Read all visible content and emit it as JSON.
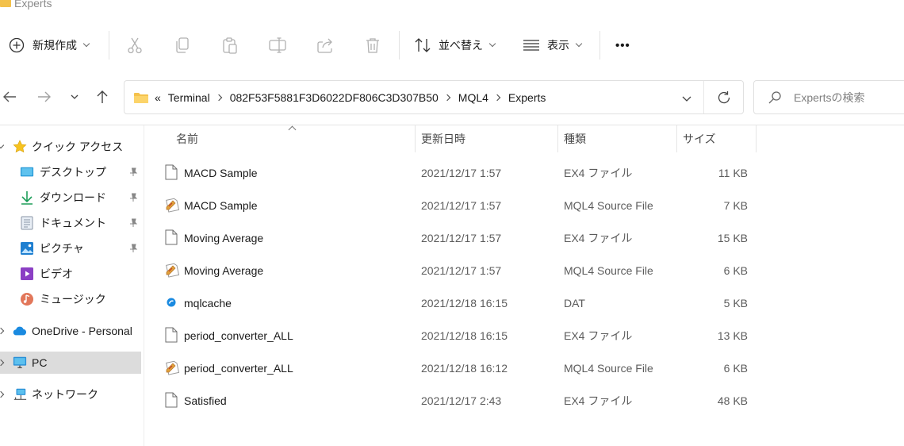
{
  "window": {
    "title": "Experts"
  },
  "toolbar": {
    "new_label": "新規作成",
    "sort_label": "並べ替え",
    "view_label": "表示",
    "more_label": "•••"
  },
  "address": {
    "overflow": "«",
    "crumbs": [
      "Terminal",
      "082F53F5881F3D6022DF806C3D307B50",
      "MQL4",
      "Experts"
    ]
  },
  "search": {
    "placeholder": "Expertsの検索"
  },
  "sidebar": {
    "items": [
      {
        "label": "クイック アクセス",
        "icon": "star-icon"
      },
      {
        "label": "デスクトップ",
        "icon": "desktop-icon",
        "pinned": true
      },
      {
        "label": "ダウンロード",
        "icon": "download-icon",
        "pinned": true
      },
      {
        "label": "ドキュメント",
        "icon": "document-icon",
        "pinned": true
      },
      {
        "label": "ピクチャ",
        "icon": "pictures-icon",
        "pinned": true
      },
      {
        "label": "ビデオ",
        "icon": "video-icon"
      },
      {
        "label": "ミュージック",
        "icon": "music-icon"
      },
      {
        "label": "OneDrive - Personal",
        "icon": "cloud-icon"
      },
      {
        "label": "PC",
        "icon": "pc-icon",
        "selected": true
      },
      {
        "label": "ネットワーク",
        "icon": "network-icon"
      }
    ]
  },
  "columns": {
    "name": "名前",
    "date": "更新日時",
    "type": "種類",
    "size": "サイズ"
  },
  "files": [
    {
      "name": "MACD Sample",
      "date": "2021/12/17 1:57",
      "type": "EX4 ファイル",
      "size": "11 KB",
      "icon": "file-icon"
    },
    {
      "name": "MACD Sample",
      "date": "2021/12/17 1:57",
      "type": "MQL4 Source File",
      "size": "7 KB",
      "icon": "mql-source-icon"
    },
    {
      "name": "Moving Average",
      "date": "2021/12/17 1:57",
      "type": "EX4 ファイル",
      "size": "15 KB",
      "icon": "file-icon"
    },
    {
      "name": "Moving Average",
      "date": "2021/12/17 1:57",
      "type": "MQL4 Source File",
      "size": "6 KB",
      "icon": "mql-source-icon"
    },
    {
      "name": "mqlcache",
      "date": "2021/12/18 16:15",
      "type": "DAT",
      "size": "5 KB",
      "icon": "dat-icon"
    },
    {
      "name": "period_converter_ALL",
      "date": "2021/12/18 16:15",
      "type": "EX4 ファイル",
      "size": "13 KB",
      "icon": "file-icon"
    },
    {
      "name": "period_converter_ALL",
      "date": "2021/12/18 16:12",
      "type": "MQL4 Source File",
      "size": "6 KB",
      "icon": "mql-source-icon"
    },
    {
      "name": "Satisfied",
      "date": "2021/12/17 2:43",
      "type": "EX4 ファイル",
      "size": "48 KB",
      "icon": "file-icon"
    }
  ]
}
